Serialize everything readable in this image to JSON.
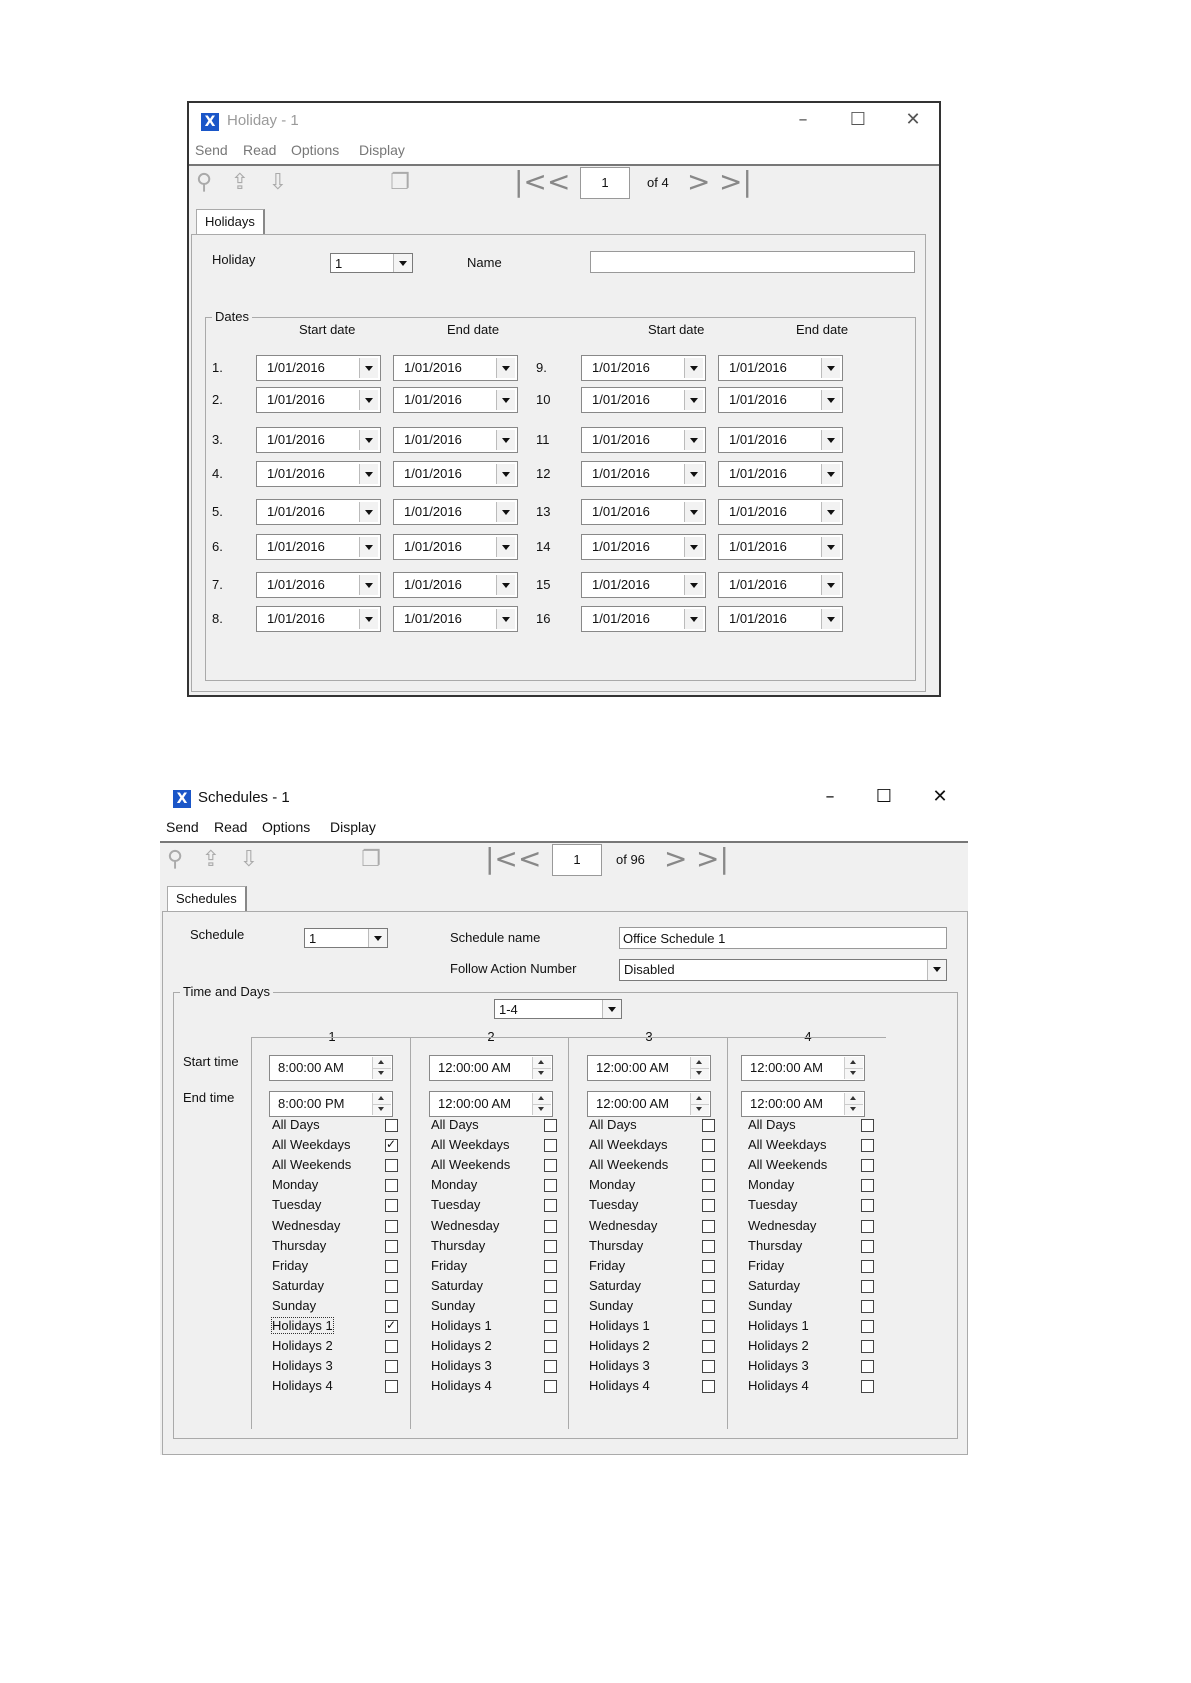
{
  "holiday_window": {
    "title": "Holiday - 1",
    "menu": [
      "Send",
      "Read",
      "Options",
      "Display"
    ],
    "toolbar": {
      "page": "1",
      "of": "of 4"
    },
    "tab": "Holidays",
    "holiday_label": "Holiday",
    "holiday_value": "1",
    "name_label": "Name",
    "name_value": "",
    "dates_legend": "Dates",
    "headers": {
      "start_left": "Start date",
      "end_left": "End date",
      "start_right": "Start date",
      "end_right": "End date"
    },
    "row_labels_left": [
      "1.",
      "2.",
      "3.",
      "4.",
      "5.",
      "6.",
      "7.",
      "8."
    ],
    "row_labels_right": [
      "9.",
      "10",
      "11",
      "12",
      "13",
      "14",
      "15",
      "16"
    ],
    "date_value": "1/01/2016"
  },
  "schedules_window": {
    "title": "Schedules - 1",
    "menu": [
      "Send",
      "Read",
      "Options",
      "Display"
    ],
    "toolbar": {
      "page": "1",
      "of": "of 96"
    },
    "tab": "Schedules",
    "schedule_label": "Schedule",
    "schedule_value": "1",
    "schedule_name_label": "Schedule name",
    "schedule_name_value": "Office Schedule 1",
    "follow_label": "Follow Action Number",
    "follow_value": "Disabled",
    "time_legend": "Time and Days",
    "range_value": "1-4",
    "start_time_label": "Start time",
    "end_time_label": "End time",
    "columns": [
      {
        "head": "1",
        "start": "8:00:00 AM",
        "end": "8:00:00 PM"
      },
      {
        "head": "2",
        "start": "12:00:00 AM",
        "end": "12:00:00 AM"
      },
      {
        "head": "3",
        "start": "12:00:00 AM",
        "end": "12:00:00 AM"
      },
      {
        "head": "4",
        "start": "12:00:00 AM",
        "end": "12:00:00 AM"
      }
    ],
    "day_labels": [
      "All Days",
      "All Weekdays",
      "All Weekends",
      "Monday",
      "Tuesday",
      "Wednesday",
      "Thursday",
      "Friday",
      "Saturday",
      "Sunday",
      "Holidays 1",
      "Holidays 2",
      "Holidays 3",
      "Holidays 4"
    ],
    "checked": [
      [
        false,
        true,
        false,
        false,
        false,
        false,
        false,
        false,
        false,
        false,
        true,
        false,
        false,
        false
      ],
      [
        false,
        false,
        false,
        false,
        false,
        false,
        false,
        false,
        false,
        false,
        false,
        false,
        false,
        false
      ],
      [
        false,
        false,
        false,
        false,
        false,
        false,
        false,
        false,
        false,
        false,
        false,
        false,
        false,
        false
      ],
      [
        false,
        false,
        false,
        false,
        false,
        false,
        false,
        false,
        false,
        false,
        false,
        false,
        false,
        false
      ]
    ]
  }
}
